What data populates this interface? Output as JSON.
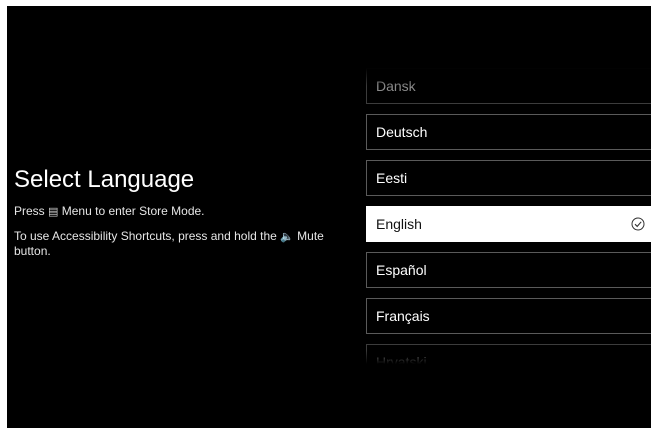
{
  "page": {
    "title": "Select Language",
    "store_mode_prefix": "Press ",
    "store_mode_icon": "menu-icon",
    "store_mode_icon_glyph": "▤",
    "store_mode_suffix": " Menu to enter Store Mode.",
    "accessibility_prefix": "To use Accessibility Shortcuts, press and hold the ",
    "accessibility_icon": "mute-icon",
    "accessibility_icon_glyph": "🔈",
    "accessibility_suffix": " Mute button."
  },
  "languages": {
    "selected": "English",
    "items": [
      {
        "label": "Dansk"
      },
      {
        "label": "Deutsch"
      },
      {
        "label": "Eesti"
      },
      {
        "label": "English"
      },
      {
        "label": "Español"
      },
      {
        "label": "Français"
      },
      {
        "label": "Hrvatski"
      }
    ],
    "check_icon": "check-circle-icon"
  },
  "colors": {
    "background": "#000000",
    "text": "#ffffff",
    "item_border": "#5a5a5a",
    "selected_background": "#ffffff",
    "selected_text": "#111111"
  }
}
